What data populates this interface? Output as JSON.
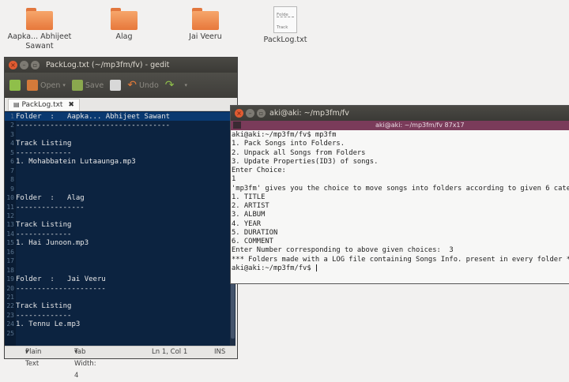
{
  "desktop": {
    "icons": [
      {
        "label": "Aapka... Abhijeet Sawant",
        "type": "folder"
      },
      {
        "label": "Alag",
        "type": "folder"
      },
      {
        "label": "Jai Veeru",
        "type": "folder"
      },
      {
        "label": "PackLog.txt",
        "type": "document",
        "thumb_top": "Folde",
        "thumb_bottom": "Track"
      }
    ]
  },
  "gedit": {
    "title": "PackLog.txt (~/mp3fm/fv) - gedit",
    "toolbar": {
      "open": "Open",
      "save": "Save",
      "undo": "Undo"
    },
    "tab": "PackLog.txt",
    "lines": [
      {
        "n": "1",
        "t": "Folder  :   Aapka... Abhijeet Sawant"
      },
      {
        "n": "2",
        "t": "------------------------------------"
      },
      {
        "n": "3",
        "t": ""
      },
      {
        "n": "4",
        "t": "Track Listing"
      },
      {
        "n": "5",
        "t": "-------------"
      },
      {
        "n": "6",
        "t": "1. Mohabbatein Lutaaunga.mp3"
      },
      {
        "n": "7",
        "t": ""
      },
      {
        "n": "8",
        "t": ""
      },
      {
        "n": "9",
        "t": ""
      },
      {
        "n": "10",
        "t": "Folder  :   Alag"
      },
      {
        "n": "11",
        "t": "----------------"
      },
      {
        "n": "12",
        "t": ""
      },
      {
        "n": "13",
        "t": "Track Listing"
      },
      {
        "n": "14",
        "t": "-------------"
      },
      {
        "n": "15",
        "t": "1. Hai Junoon.mp3"
      },
      {
        "n": "16",
        "t": ""
      },
      {
        "n": "17",
        "t": ""
      },
      {
        "n": "18",
        "t": ""
      },
      {
        "n": "19",
        "t": "Folder  :   Jai Veeru"
      },
      {
        "n": "20",
        "t": "---------------------"
      },
      {
        "n": "21",
        "t": ""
      },
      {
        "n": "22",
        "t": "Track Listing"
      },
      {
        "n": "23",
        "t": "-------------"
      },
      {
        "n": "24",
        "t": "1. Tennu Le.mp3"
      },
      {
        "n": "25",
        "t": ""
      }
    ],
    "status": {
      "lang": "Plain Text",
      "tabwidth": "Tab Width:  4",
      "pos": "Ln 1, Col 1",
      "mode": "INS"
    }
  },
  "terminal": {
    "title": "aki@aki: ~/mp3fm/fv",
    "tab_label": "aki@aki: ~/mp3fm/fv 87x17",
    "lines": [
      "aki@aki:~/mp3fm/fv$ mp3fm",
      "1. Pack Songs into Folders.",
      "2. Unpack all Songs from Folders",
      "3. Update Properties(ID3) of songs.",
      "Enter Choice:",
      "1",
      "'mp3fm' gives you the choice to move songs into folders according to given 6 cate",
      "1. TITLE",
      "2. ARTIST",
      "3. ALBUM",
      "4. YEAR",
      "5. DURATION",
      "6. COMMENT",
      "Enter Number corresponding to above given choices:  3",
      "*** Folders made with a LOG file containing Songs Info. present in every folder *",
      "aki@aki:~/mp3fm/fv$ "
    ]
  }
}
